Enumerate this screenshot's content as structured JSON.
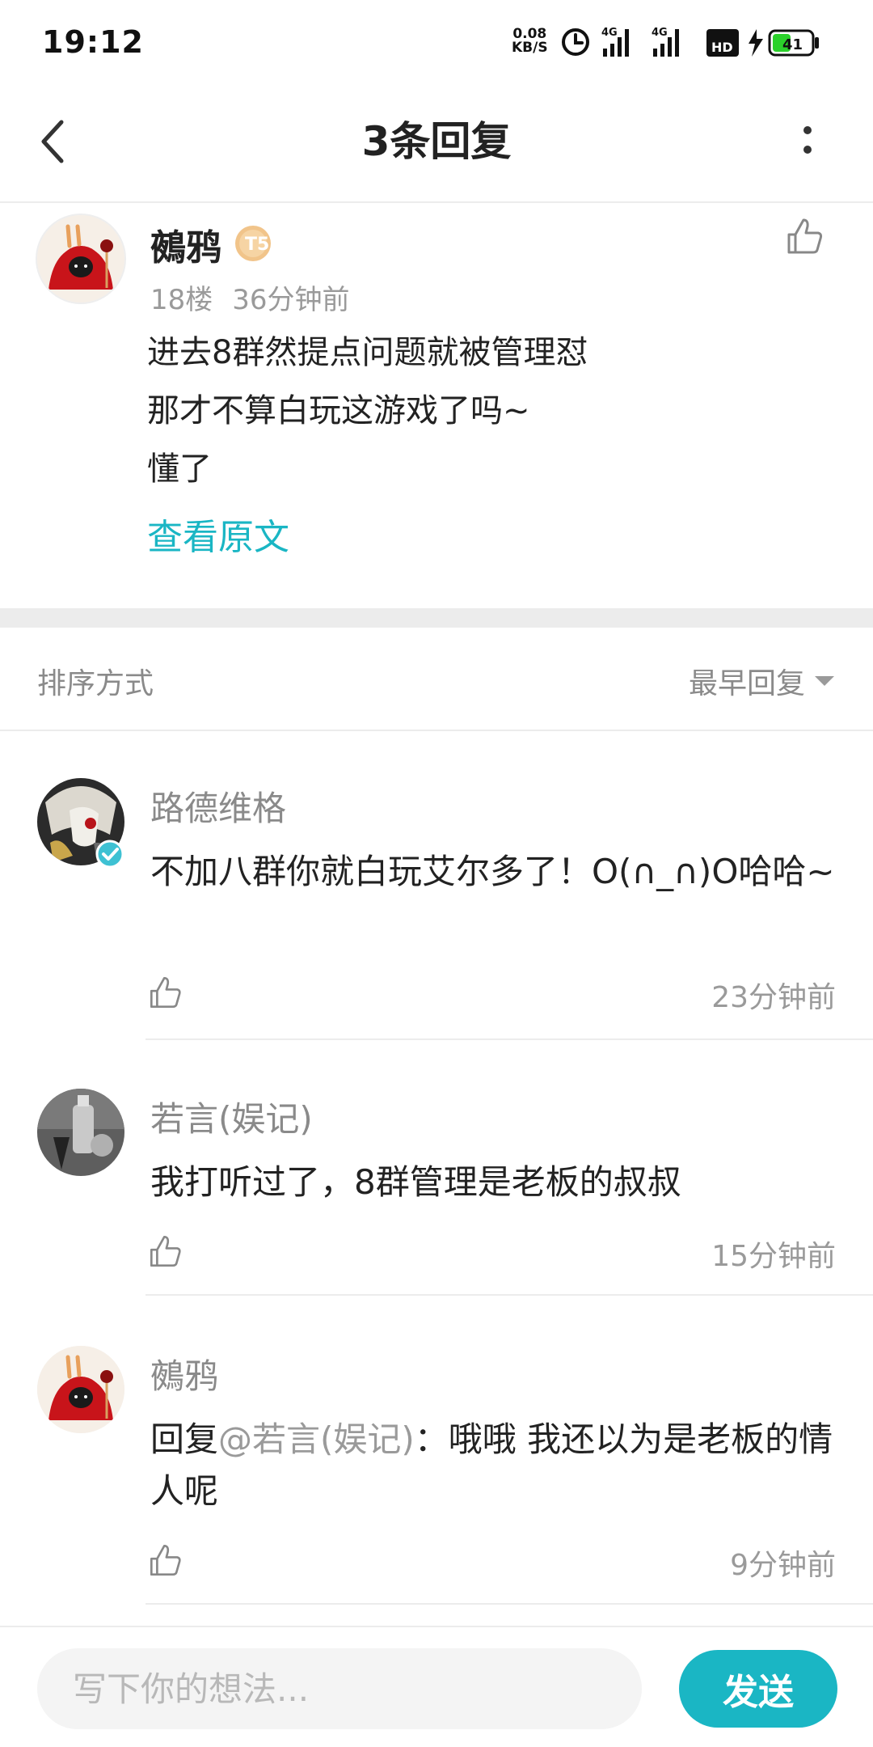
{
  "status_bar": {
    "time": "19:12",
    "net_speed_value": "0.08",
    "net_speed_unit": "KB/S",
    "signal1_label": "4G",
    "signal2_label": "4G",
    "hd_label": "HD",
    "battery_level": "41"
  },
  "header": {
    "title": "3条回复"
  },
  "post": {
    "author": "鵺鸦",
    "level_badge": "T5",
    "floor": "18楼",
    "time": "36分钟前",
    "lines": [
      "进去8群然提点问题就被管理怼",
      "那才不算白玩这游戏了吗~",
      "懂了"
    ],
    "view_original": "查看原文"
  },
  "sort": {
    "label": "排序方式",
    "selected": "最早回复"
  },
  "replies": [
    {
      "author": "路德维格",
      "text": "不加八群你就白玩艾尔多了！O(∩_∩)O哈哈~",
      "time": "23分钟前"
    },
    {
      "author": "若言(娱记)",
      "text": "我打听过了，8群管理是老板的叔叔",
      "time": "15分钟前"
    },
    {
      "author": "鵺鸦",
      "reply_prefix": "回复",
      "mention": "@若言(娱记)",
      "text": "：哦哦 我还以为是老板的情人呢",
      "time": "9分钟前"
    }
  ],
  "composer": {
    "placeholder": "写下你的想法...",
    "send_label": "发送"
  },
  "colors": {
    "accent": "#1ab6c4",
    "muted_text": "#9a9a9a",
    "divider": "#ececec"
  },
  "icons": {
    "back": "chevron-left-icon",
    "more": "more-vertical-icon",
    "like": "thumbs-up-icon",
    "verified": "verified-check-icon",
    "sort_dropdown": "caret-down-icon"
  }
}
